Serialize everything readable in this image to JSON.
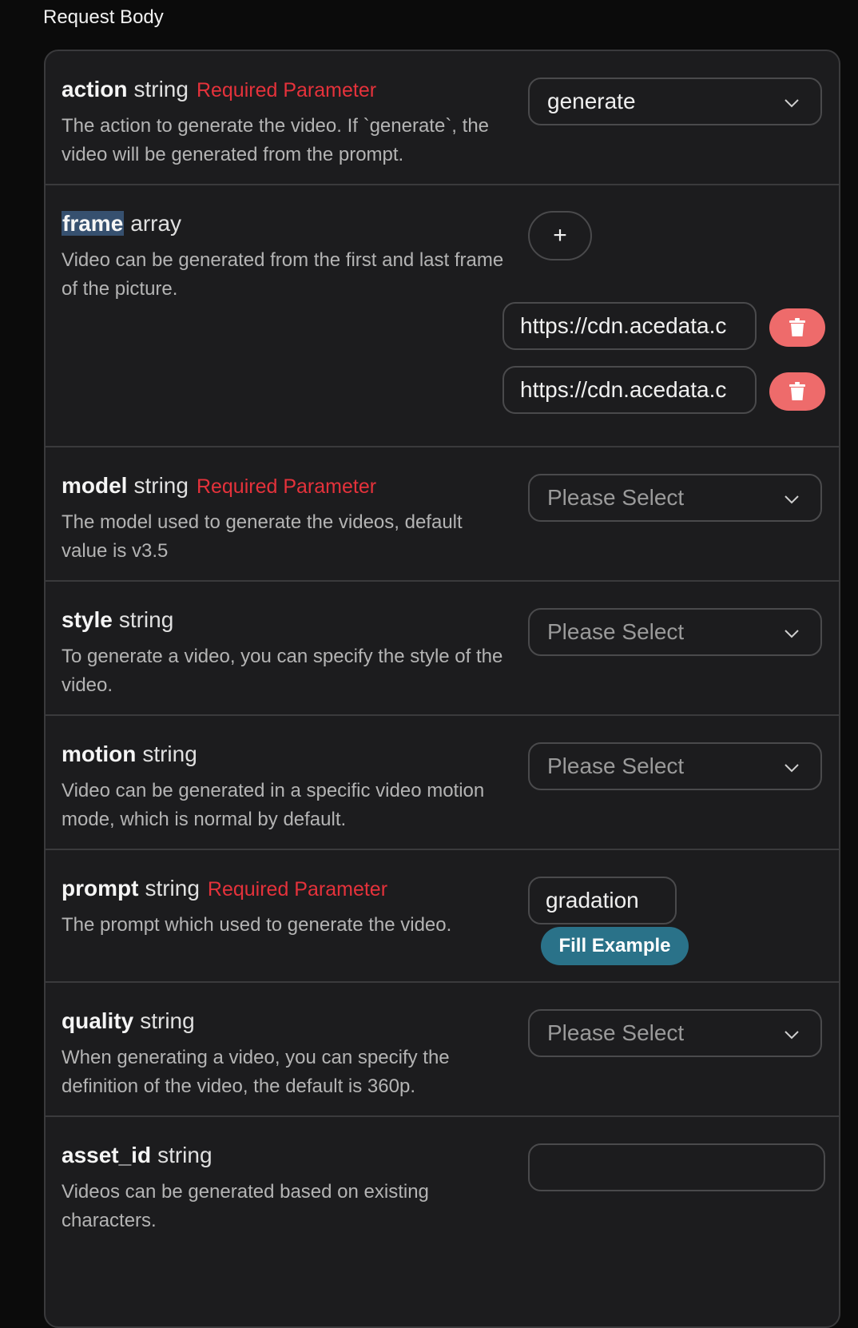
{
  "section_title": "Request Body",
  "required_label": "Required Parameter",
  "params": {
    "action": {
      "name": "action",
      "type": "string",
      "required": true,
      "description": "The action to generate the video. If `generate`, the video will be generated from the prompt.",
      "value": "generate"
    },
    "frame": {
      "name": "frame",
      "type": "array",
      "description": "Video can be generated from the first and last frame of the picture.",
      "add_label": "+",
      "items": [
        "https://cdn.acedata.c",
        "https://cdn.acedata.c"
      ]
    },
    "model": {
      "name": "model",
      "type": "string",
      "required": true,
      "description": "The model used to generate the videos, default value is v3.5",
      "placeholder": "Please Select"
    },
    "style": {
      "name": "style",
      "type": "string",
      "description": "To generate a video, you can specify the style of the video.",
      "placeholder": "Please Select"
    },
    "motion": {
      "name": "motion",
      "type": "string",
      "description": "Video can be generated in a specific video motion mode, which is normal by default.",
      "placeholder": "Please Select"
    },
    "prompt": {
      "name": "prompt",
      "type": "string",
      "required": true,
      "description": "The prompt which used to generate the video.",
      "value": "gradation",
      "fill_example_label": "Fill Example"
    },
    "quality": {
      "name": "quality",
      "type": "string",
      "description": "When generating a video, you can specify the definition of the video, the default is 360p.",
      "placeholder": "Please Select"
    },
    "asset_id": {
      "name": "asset_id",
      "type": "string",
      "description": "Videos can be generated based on existing characters.",
      "value": ""
    }
  },
  "colors": {
    "background": "#0b0b0b",
    "panel": "#1c1c1e",
    "required": "#e5323b",
    "delete_button": "#ee6b6b",
    "fill_example_button": "#2a7289",
    "highlight": "#36506f"
  },
  "icons": {
    "dropdown": "chevron-down-icon",
    "delete": "trash-icon",
    "add": "plus-icon"
  }
}
